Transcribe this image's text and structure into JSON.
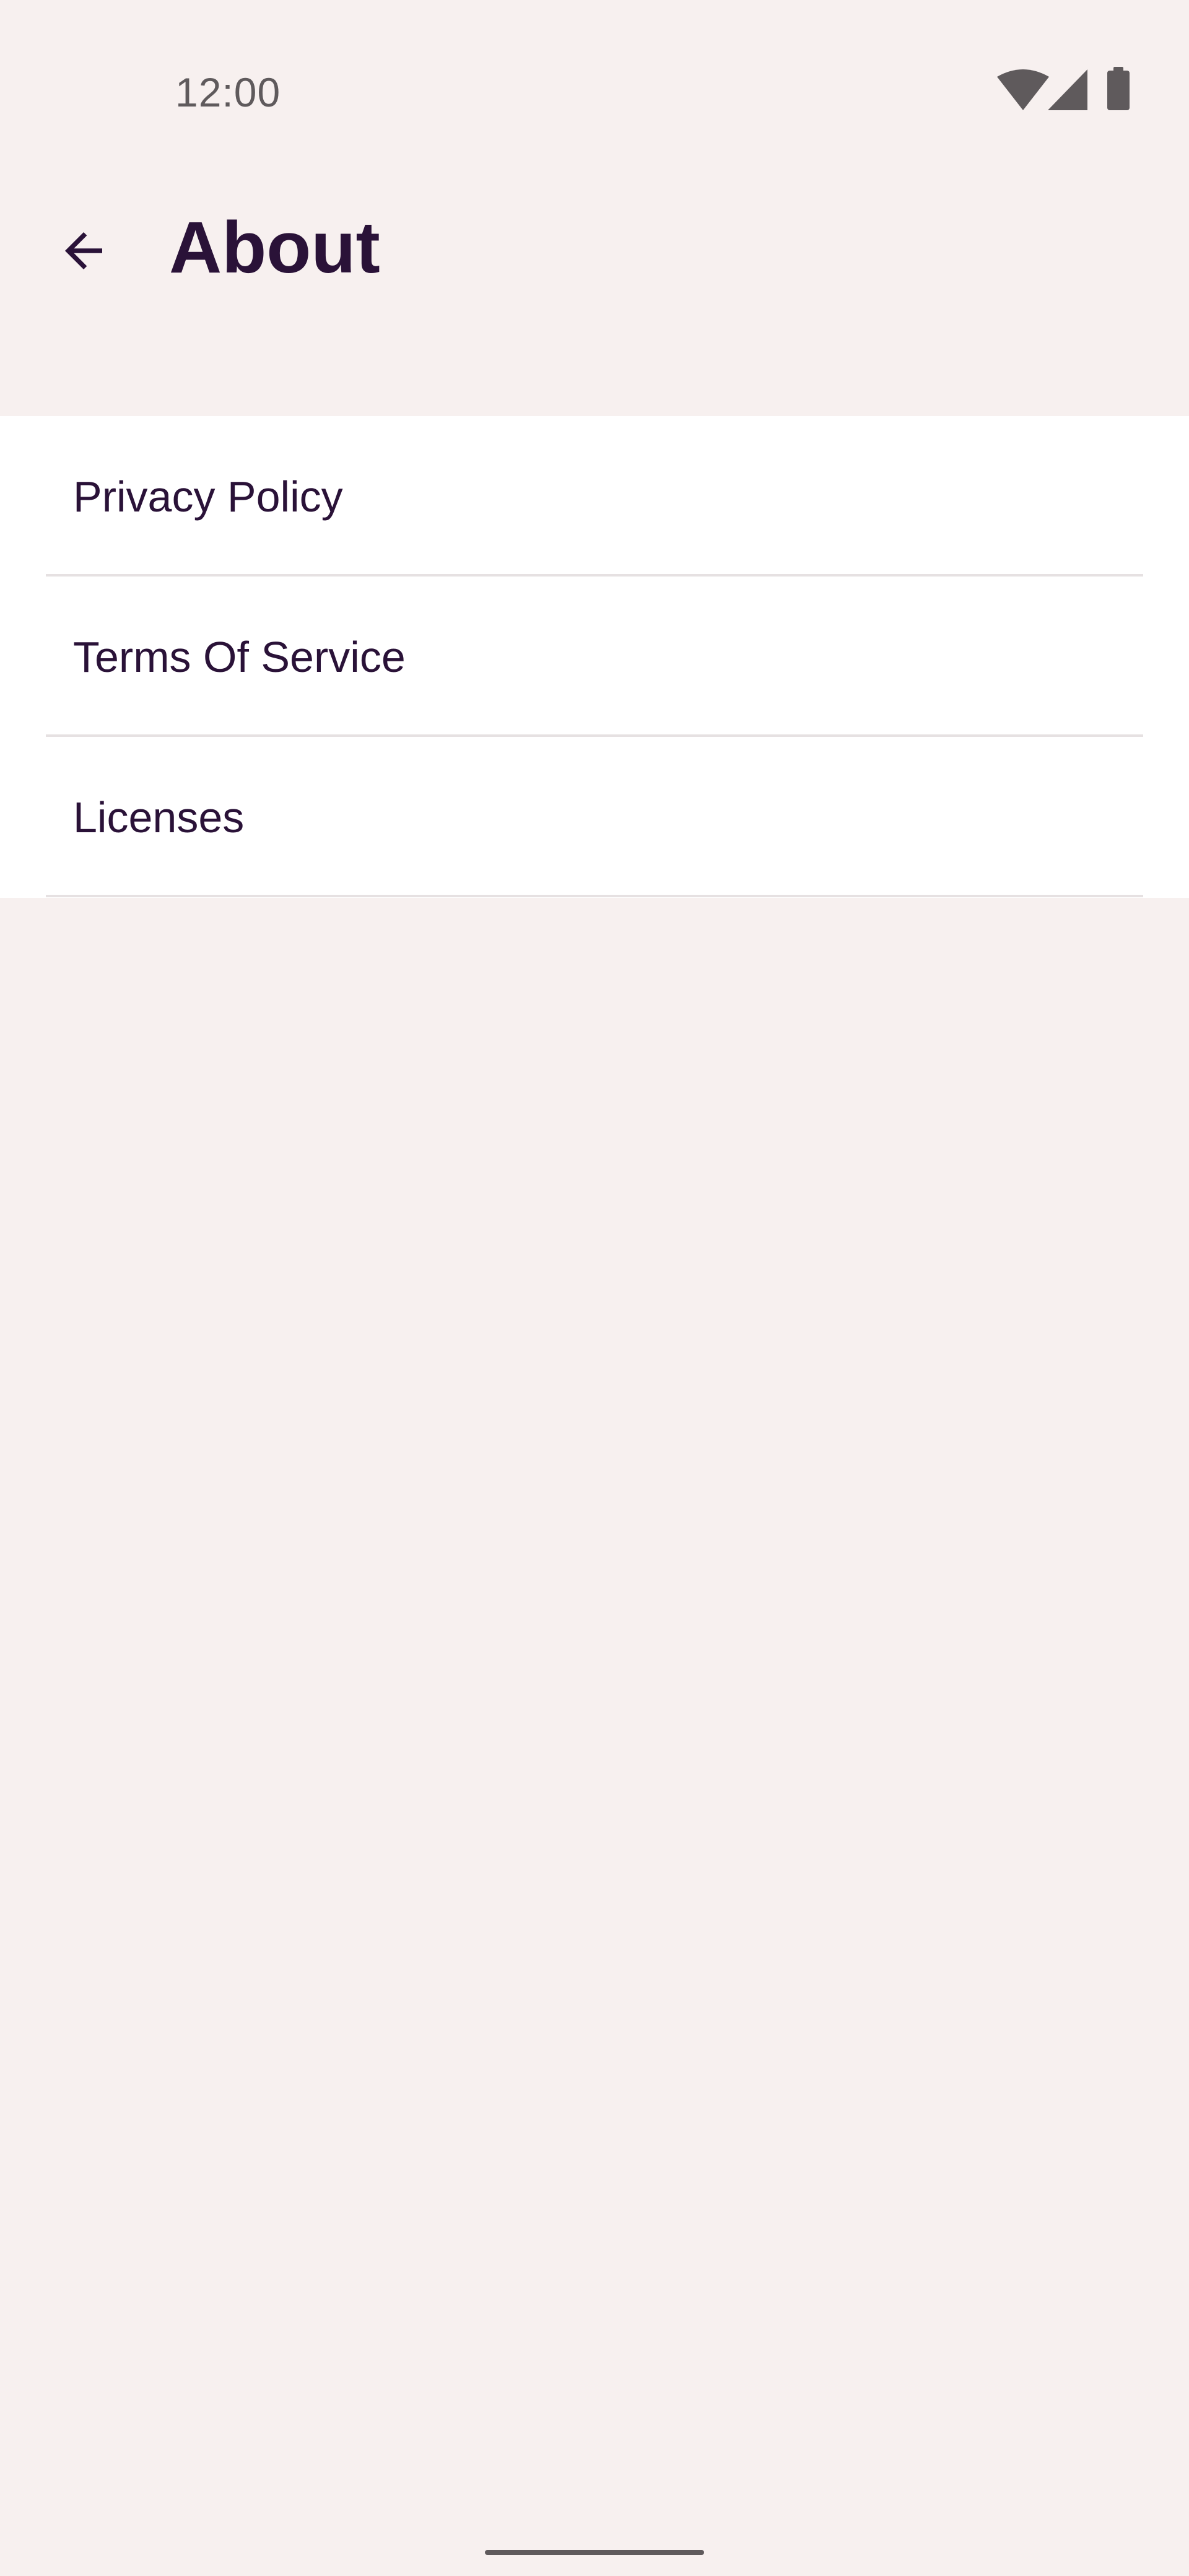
{
  "status_bar": {
    "time": "12:00",
    "icons": [
      "wifi-icon",
      "cellular-signal-icon",
      "battery-icon"
    ]
  },
  "app_bar": {
    "back_icon": "arrow-back-icon",
    "title": "About"
  },
  "list": {
    "items": [
      {
        "label": "Privacy Policy"
      },
      {
        "label": "Terms Of Service"
      },
      {
        "label": "Licenses"
      }
    ]
  },
  "colors": {
    "background": "#f7f0ef",
    "surface": "#ffffff",
    "on_surface": "#2a1238",
    "status_text": "#5f5a5c",
    "divider": "#e6e1e2"
  }
}
